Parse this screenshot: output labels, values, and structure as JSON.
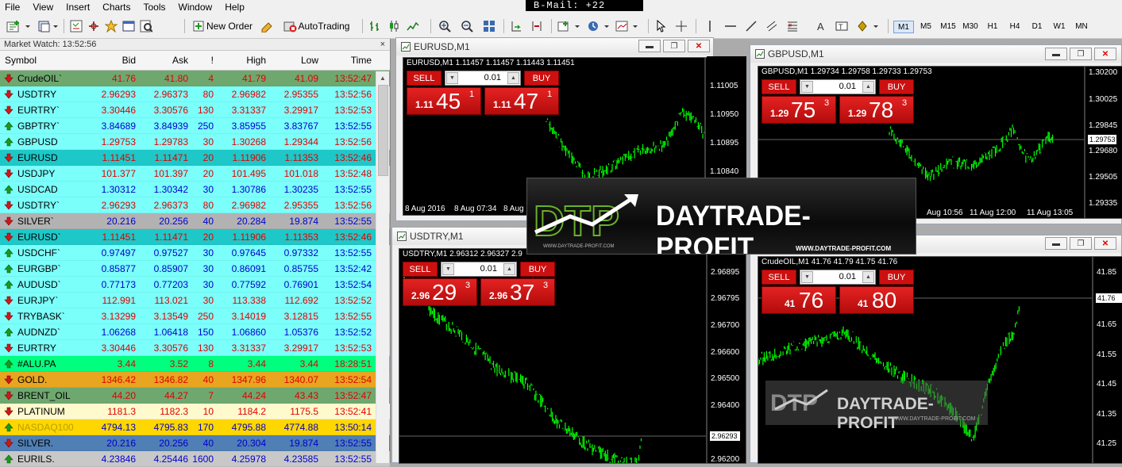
{
  "menu": [
    "File",
    "View",
    "Insert",
    "Charts",
    "Tools",
    "Window",
    "Help"
  ],
  "bmail": "B-Mail: +22",
  "toolbar": {
    "new_order": "New Order",
    "autotrading": "AutoTrading",
    "timeframes": [
      "M1",
      "M5",
      "M15",
      "M30",
      "H1",
      "H4",
      "D1",
      "W1",
      "MN"
    ],
    "active_timeframe": "M1"
  },
  "market_watch": {
    "title": "Market Watch: 13:52:56",
    "close": "×",
    "headers": {
      "symbol": "Symbol",
      "bid": "Bid",
      "ask": "Ask",
      "spread": "!",
      "high": "High",
      "low": "Low",
      "time": "Time"
    },
    "rows": [
      {
        "symbol": "CrudeOIL`",
        "bid": "41.76",
        "ask": "41.80",
        "spread": "4",
        "high": "41.79",
        "low": "41.09",
        "time": "13:52:47",
        "bg": "#6fa86f",
        "dir": "down",
        "color": "red"
      },
      {
        "symbol": "USDTRY",
        "bid": "2.96293",
        "ask": "2.96373",
        "spread": "80",
        "high": "2.96982",
        "low": "2.95355",
        "time": "13:52:56",
        "bg": "#7bfffb",
        "dir": "down",
        "color": "red"
      },
      {
        "symbol": "EURTRY`",
        "bid": "3.30446",
        "ask": "3.30576",
        "spread": "130",
        "high": "3.31337",
        "low": "3.29917",
        "time": "13:52:53",
        "bg": "#7bfffb",
        "dir": "down",
        "color": "red"
      },
      {
        "symbol": "GBPTRY`",
        "bid": "3.84689",
        "ask": "3.84939",
        "spread": "250",
        "high": "3.85955",
        "low": "3.83767",
        "time": "13:52:55",
        "bg": "#7bfffb",
        "dir": "up",
        "color": "blue"
      },
      {
        "symbol": "GBPUSD",
        "bid": "1.29753",
        "ask": "1.29783",
        "spread": "30",
        "high": "1.30268",
        "low": "1.29344",
        "time": "13:52:56",
        "bg": "#7bfffb",
        "dir": "up",
        "color": "red"
      },
      {
        "symbol": "EURUSD",
        "bid": "1.11451",
        "ask": "1.11471",
        "spread": "20",
        "high": "1.11906",
        "low": "1.11353",
        "time": "13:52:46",
        "bg": "#1ec8c8",
        "dir": "down",
        "color": "red"
      },
      {
        "symbol": "USDJPY",
        "bid": "101.377",
        "ask": "101.397",
        "spread": "20",
        "high": "101.495",
        "low": "101.018",
        "time": "13:52:48",
        "bg": "#7bfffb",
        "dir": "down",
        "color": "red"
      },
      {
        "symbol": "USDCAD",
        "bid": "1.30312",
        "ask": "1.30342",
        "spread": "30",
        "high": "1.30786",
        "low": "1.30235",
        "time": "13:52:55",
        "bg": "#7bfffb",
        "dir": "up",
        "color": "blue"
      },
      {
        "symbol": "USDTRY`",
        "bid": "2.96293",
        "ask": "2.96373",
        "spread": "80",
        "high": "2.96982",
        "low": "2.95355",
        "time": "13:52:56",
        "bg": "#7bfffb",
        "dir": "down",
        "color": "red"
      },
      {
        "symbol": "SILVER`",
        "bid": "20.216",
        "ask": "20.256",
        "spread": "40",
        "high": "20.284",
        "low": "19.874",
        "time": "13:52:55",
        "bg": "#b2b2b2",
        "dir": "down",
        "color": "blue"
      },
      {
        "symbol": "EURUSD`",
        "bid": "1.11451",
        "ask": "1.11471",
        "spread": "20",
        "high": "1.11906",
        "low": "1.11353",
        "time": "13:52:46",
        "bg": "#1ec8c8",
        "dir": "down",
        "color": "red"
      },
      {
        "symbol": "USDCHF`",
        "bid": "0.97497",
        "ask": "0.97527",
        "spread": "30",
        "high": "0.97645",
        "low": "0.97332",
        "time": "13:52:55",
        "bg": "#7bfffb",
        "dir": "up",
        "color": "blue"
      },
      {
        "symbol": "EURGBP`",
        "bid": "0.85877",
        "ask": "0.85907",
        "spread": "30",
        "high": "0.86091",
        "low": "0.85755",
        "time": "13:52:42",
        "bg": "#7bfffb",
        "dir": "up",
        "color": "blue"
      },
      {
        "symbol": "AUDUSD`",
        "bid": "0.77173",
        "ask": "0.77203",
        "spread": "30",
        "high": "0.77592",
        "low": "0.76901",
        "time": "13:52:54",
        "bg": "#7bfffb",
        "dir": "up",
        "color": "blue"
      },
      {
        "symbol": "EURJPY`",
        "bid": "112.991",
        "ask": "113.021",
        "spread": "30",
        "high": "113.338",
        "low": "112.692",
        "time": "13:52:52",
        "bg": "#7bfffb",
        "dir": "down",
        "color": "red"
      },
      {
        "symbol": "TRYBASK`",
        "bid": "3.13299",
        "ask": "3.13549",
        "spread": "250",
        "high": "3.14019",
        "low": "3.12815",
        "time": "13:52:55",
        "bg": "#7bfffb",
        "dir": "down",
        "color": "red"
      },
      {
        "symbol": "AUDNZD`",
        "bid": "1.06268",
        "ask": "1.06418",
        "spread": "150",
        "high": "1.06860",
        "low": "1.05376",
        "time": "13:52:52",
        "bg": "#7bfffb",
        "dir": "up",
        "color": "blue"
      },
      {
        "symbol": "EURTRY",
        "bid": "3.30446",
        "ask": "3.30576",
        "spread": "130",
        "high": "3.31337",
        "low": "3.29917",
        "time": "13:52:53",
        "bg": "#7bfffb",
        "dir": "down",
        "color": "red"
      },
      {
        "symbol": "#ALU.PA",
        "bid": "3.44",
        "ask": "3.52",
        "spread": "8",
        "high": "3.44",
        "low": "3.44",
        "time": "18:28:51",
        "bg": "#00ff7f",
        "dir": "up",
        "color": "red"
      },
      {
        "symbol": "GOLD.",
        "bid": "1346.42",
        "ask": "1346.82",
        "spread": "40",
        "high": "1347.96",
        "low": "1340.07",
        "time": "13:52:54",
        "bg": "#e8a520",
        "dir": "down",
        "color": "red"
      },
      {
        "symbol": "BRENT_OIL",
        "bid": "44.20",
        "ask": "44.27",
        "spread": "7",
        "high": "44.24",
        "low": "43.43",
        "time": "13:52:47",
        "bg": "#6fa86f",
        "dir": "down",
        "color": "red"
      },
      {
        "symbol": "PLATINUM",
        "bid": "1181.3",
        "ask": "1182.3",
        "spread": "10",
        "high": "1184.2",
        "low": "1175.5",
        "time": "13:52:41",
        "bg": "#fffacd",
        "dir": "down",
        "color": "red"
      },
      {
        "symbol": "NASDAQ100",
        "bid": "4794.13",
        "ask": "4795.83",
        "spread": "170",
        "high": "4795.88",
        "low": "4774.88",
        "time": "13:50:14",
        "bg": "#ffd700",
        "dir": "up",
        "color": "blue",
        "symcolor": "#b8a000"
      },
      {
        "symbol": "SILVER.",
        "bid": "20.216",
        "ask": "20.256",
        "spread": "40",
        "high": "20.304",
        "low": "19.874",
        "time": "13:52:55",
        "bg": "#4f7fb4",
        "dir": "down",
        "color": "blue"
      },
      {
        "symbol": "EURILS.",
        "bid": "4.23846",
        "ask": "4.25446",
        "spread": "1600",
        "high": "4.25978",
        "low": "4.23585",
        "time": "13:52:55",
        "bg": "#c8c8c8",
        "dir": "up",
        "color": "blue"
      }
    ]
  },
  "windows": {
    "eurusd": {
      "title": "EURUSD,M1",
      "ohlc": "EURUSD,M1  1.11457 1.11457 1.11443 1.11451",
      "sell": "SELL",
      "buy": "BUY",
      "lot": "0.01",
      "sell_pre": "1.11",
      "sell_big": "45",
      "sell_sup": "1",
      "buy_pre": "1.11",
      "buy_big": "47",
      "buy_sup": "1",
      "yaxis": [
        "1.11005",
        "1.10950",
        "1.10895",
        "1.10840"
      ],
      "xaxis": [
        "8 Aug 2016",
        "8 Aug 07:34",
        "8 Aug"
      ]
    },
    "gbpusd": {
      "title": "GBPUSD,M1",
      "ohlc": "GBPUSD,M1  1.29734 1.29758 1.29733 1.29753",
      "sell": "SELL",
      "buy": "BUY",
      "lot": "0.01",
      "sell_pre": "1.29",
      "sell_big": "75",
      "sell_sup": "3",
      "buy_pre": "1.29",
      "buy_big": "78",
      "buy_sup": "3",
      "yaxis": [
        "1.30200",
        "1.30025",
        "1.29845",
        "1.29680",
        "1.29505",
        "1.29335"
      ],
      "price_label": "1.29753",
      "xaxis": [
        "Aug 10:56",
        "11 Aug 12:00",
        "11 Aug 13:05"
      ]
    },
    "usdtry": {
      "title": "USDTRY,M1",
      "ohlc": "USDTRY,M1  2.96312 2.96327 2.9",
      "sell": "SELL",
      "buy": "BUY",
      "lot": "0.01",
      "sell_pre": "2.96",
      "sell_big": "29",
      "sell_sup": "3",
      "buy_pre": "2.96",
      "buy_big": "37",
      "buy_sup": "3",
      "yaxis": [
        "2.96895",
        "2.96795",
        "2.96700",
        "2.96600",
        "2.96500",
        "2.96400",
        "2.96200"
      ],
      "price_label": "2.96293"
    },
    "crudeoil": {
      "title": "",
      "ohlc": "CrudeOIL,M1  41.76 41.79 41.75 41.76",
      "sell": "SELL",
      "buy": "BUY",
      "lot": "0.01",
      "sell_pre": "41",
      "sell_big": "76",
      "sell_sup": "",
      "buy_pre": "41",
      "buy_big": "80",
      "buy_sup": "",
      "yaxis": [
        "41.85",
        "41.75",
        "41.65",
        "41.55",
        "41.45",
        "41.35",
        "41.25"
      ],
      "price_label": "41.76"
    }
  },
  "banner": {
    "brand": "DAYTRADE-PROFIT",
    "url": "WWW.DAYTRADE-PROFIT.COM",
    "url2": "WWW.DAYTRADE-PROFIT.COM"
  },
  "watermark": {
    "brand": "DAYTRADE-PROFIT",
    "url": "WWW.DAYTRADE-PROFIT.COM"
  },
  "colors": {
    "candle": "#00ff00",
    "chart_bg": "#000000",
    "trade_red": "#cc1010"
  }
}
